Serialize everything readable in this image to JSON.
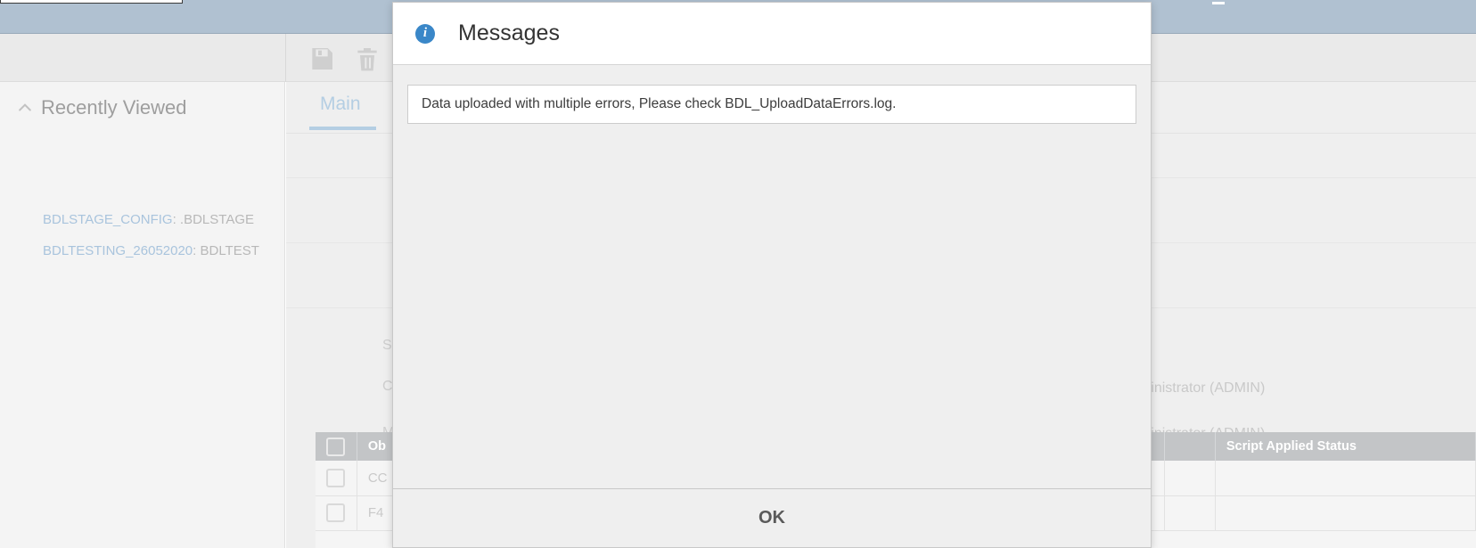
{
  "window": {
    "search_box_placeholder": "",
    "minimize_label": ""
  },
  "toolbar": {
    "save_icon": "save-icon",
    "delete_icon": "trash-icon"
  },
  "sidebar": {
    "section_title": "Recently Viewed",
    "chevron_icon": "chevron-up-icon",
    "items": [
      {
        "code": "BDLSTAGE_CONFIG",
        "rest": ": .BDLSTAGE"
      },
      {
        "code": "BDLTESTING_26052020",
        "rest": ": BDLTEST"
      }
    ]
  },
  "content": {
    "tabs": [
      {
        "label": "Main",
        "active": true
      }
    ],
    "field_labels": [
      "S",
      "C",
      "M"
    ],
    "field_values": [
      "ptiva Administrator (ADMIN)",
      "ptiva Administrator (ADMIN)"
    ],
    "grid_icon": "grid-export-icon",
    "collapse_handle_icon": "collapse-left-icon"
  },
  "table": {
    "columns": [
      {
        "key": "checkbox",
        "label": ""
      },
      {
        "key": "object",
        "label": "Ob"
      },
      {
        "key": "middle",
        "label": ""
      },
      {
        "key": "status",
        "label": "Script Applied Status"
      }
    ],
    "rows": [
      {
        "object": "CC",
        "middle": "",
        "status": ""
      },
      {
        "object": "F4",
        "middle": "",
        "status": ""
      }
    ]
  },
  "modal": {
    "icon": "info-icon",
    "title": "Messages",
    "message": "Data uploaded with multiple errors, Please check  BDL_UploadDataErrors.log.",
    "ok_label": "OK"
  },
  "colors": {
    "titlebar": "#b0c1d1",
    "accent_blue": "#3a87c8",
    "tab_blue": "#b4cee3",
    "table_header": "#c3c5c7"
  }
}
